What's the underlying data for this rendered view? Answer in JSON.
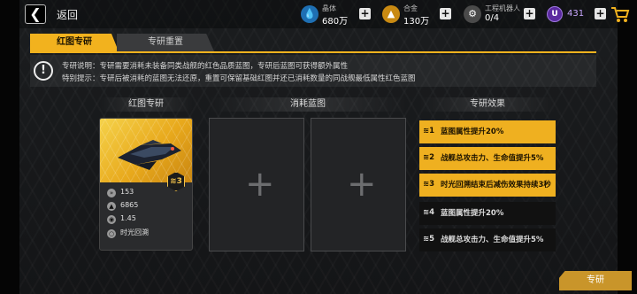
{
  "header": {
    "back_label": "返回",
    "resources": [
      {
        "name": "晶体",
        "value": "680万",
        "icon": "crystal-icon",
        "color": "#3aa3e8"
      },
      {
        "name": "合金",
        "value": "130万",
        "icon": "alloy-icon",
        "color": "#f0a81e"
      },
      {
        "name": "工程机器人",
        "value": "0/4",
        "icon": "robot-icon",
        "color": "#d0d0d0"
      }
    ],
    "gems": "431"
  },
  "tabs": [
    {
      "label": "红图专研",
      "active": true
    },
    {
      "label": "专研重置",
      "active": false
    }
  ],
  "notice": {
    "line1": "专研说明：专研需要消耗未装备同类战舰的红色品质蓝图，专研后蓝图可获得额外属性",
    "line2": "特别提示：专研后被消耗的蓝图无法还原，重置可保留基础红图并还已消耗数量的同战舰最低属性红色蓝图"
  },
  "sections": {
    "blueprint": "红图专研",
    "consume": "消耗蓝图",
    "effects": "专研效果"
  },
  "card": {
    "tier": "≋3",
    "stats": [
      {
        "icon": "speed-icon",
        "value": "153"
      },
      {
        "icon": "shield-icon",
        "value": "6865"
      },
      {
        "icon": "target-icon",
        "value": "1.45"
      },
      {
        "icon": "skill-icon",
        "value": "时光回溯"
      }
    ]
  },
  "slots": [
    "+",
    "+"
  ],
  "effects": [
    {
      "rank": "≋1",
      "text": "蓝图属性提升20%",
      "active": true
    },
    {
      "rank": "≋2",
      "text": "战舰总攻击力、生命值提升5%",
      "active": true
    },
    {
      "rank": "≋3",
      "text": "时光回溯结束后减伤效果持续3秒",
      "active": true
    },
    {
      "rank": "≋4",
      "text": "蓝图属性提升20%",
      "active": false
    },
    {
      "rank": "≋5",
      "text": "战舰总攻击力、生命值提升5%",
      "active": false
    }
  ],
  "action_label": "专研",
  "colors": {
    "accent": "#f2b21e",
    "button": "#c9952a"
  }
}
